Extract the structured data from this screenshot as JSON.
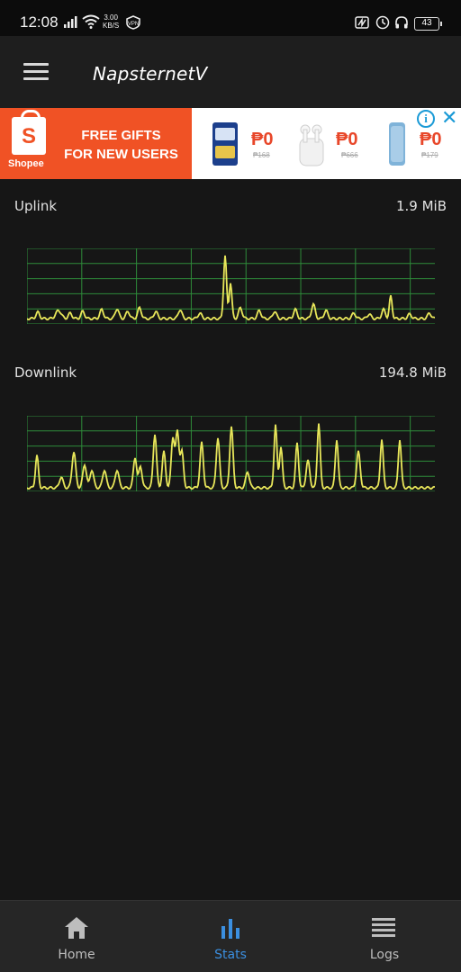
{
  "status_bar": {
    "time": "12:08",
    "net_speed_value": "3.00",
    "net_speed_unit": "KB/S",
    "battery": "43"
  },
  "app_bar": {
    "title": "NapsternetV"
  },
  "ad": {
    "brand": "Shopee",
    "headline_line1": "FREE GIFTS",
    "headline_line2": "FOR NEW USERS",
    "products": [
      {
        "price": "₱0",
        "old_price": "₱168"
      },
      {
        "price": "₱0",
        "old_price": "₱666"
      },
      {
        "price": "₱0",
        "old_price": "₱179"
      }
    ],
    "info_label": "i",
    "close_label": "✕"
  },
  "stats": {
    "uplink": {
      "label": "Uplink",
      "value": "1.9 MiB"
    },
    "downlink": {
      "label": "Downlink",
      "value": "194.8 MiB"
    }
  },
  "colors": {
    "grid": "#2e8b3a",
    "line": "#e8e65a",
    "accent": "#3b8fe0",
    "ad_orange": "#f05225"
  },
  "nav": {
    "items": [
      {
        "label": "Home",
        "icon": "home-icon",
        "active": false
      },
      {
        "label": "Stats",
        "icon": "bar-chart-icon",
        "active": true
      },
      {
        "label": "Logs",
        "icon": "list-icon",
        "active": false
      }
    ]
  }
}
